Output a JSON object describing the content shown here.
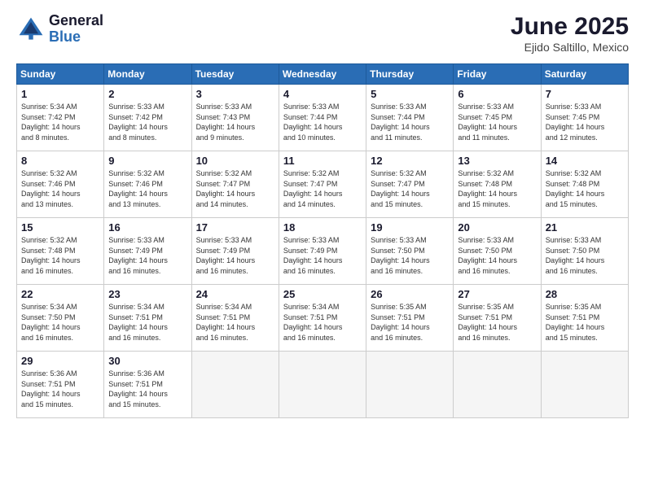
{
  "logo": {
    "general": "General",
    "blue": "Blue"
  },
  "title": "June 2025",
  "subtitle": "Ejido Saltillo, Mexico",
  "days_header": [
    "Sunday",
    "Monday",
    "Tuesday",
    "Wednesday",
    "Thursday",
    "Friday",
    "Saturday"
  ],
  "weeks": [
    [
      {
        "day": "1",
        "info": "Sunrise: 5:34 AM\nSunset: 7:42 PM\nDaylight: 14 hours\nand 8 minutes."
      },
      {
        "day": "2",
        "info": "Sunrise: 5:33 AM\nSunset: 7:42 PM\nDaylight: 14 hours\nand 8 minutes."
      },
      {
        "day": "3",
        "info": "Sunrise: 5:33 AM\nSunset: 7:43 PM\nDaylight: 14 hours\nand 9 minutes."
      },
      {
        "day": "4",
        "info": "Sunrise: 5:33 AM\nSunset: 7:44 PM\nDaylight: 14 hours\nand 10 minutes."
      },
      {
        "day": "5",
        "info": "Sunrise: 5:33 AM\nSunset: 7:44 PM\nDaylight: 14 hours\nand 11 minutes."
      },
      {
        "day": "6",
        "info": "Sunrise: 5:33 AM\nSunset: 7:45 PM\nDaylight: 14 hours\nand 11 minutes."
      },
      {
        "day": "7",
        "info": "Sunrise: 5:33 AM\nSunset: 7:45 PM\nDaylight: 14 hours\nand 12 minutes."
      }
    ],
    [
      {
        "day": "8",
        "info": "Sunrise: 5:32 AM\nSunset: 7:46 PM\nDaylight: 14 hours\nand 13 minutes."
      },
      {
        "day": "9",
        "info": "Sunrise: 5:32 AM\nSunset: 7:46 PM\nDaylight: 14 hours\nand 13 minutes."
      },
      {
        "day": "10",
        "info": "Sunrise: 5:32 AM\nSunset: 7:47 PM\nDaylight: 14 hours\nand 14 minutes."
      },
      {
        "day": "11",
        "info": "Sunrise: 5:32 AM\nSunset: 7:47 PM\nDaylight: 14 hours\nand 14 minutes."
      },
      {
        "day": "12",
        "info": "Sunrise: 5:32 AM\nSunset: 7:47 PM\nDaylight: 14 hours\nand 15 minutes."
      },
      {
        "day": "13",
        "info": "Sunrise: 5:32 AM\nSunset: 7:48 PM\nDaylight: 14 hours\nand 15 minutes."
      },
      {
        "day": "14",
        "info": "Sunrise: 5:32 AM\nSunset: 7:48 PM\nDaylight: 14 hours\nand 15 minutes."
      }
    ],
    [
      {
        "day": "15",
        "info": "Sunrise: 5:32 AM\nSunset: 7:48 PM\nDaylight: 14 hours\nand 16 minutes."
      },
      {
        "day": "16",
        "info": "Sunrise: 5:33 AM\nSunset: 7:49 PM\nDaylight: 14 hours\nand 16 minutes."
      },
      {
        "day": "17",
        "info": "Sunrise: 5:33 AM\nSunset: 7:49 PM\nDaylight: 14 hours\nand 16 minutes."
      },
      {
        "day": "18",
        "info": "Sunrise: 5:33 AM\nSunset: 7:49 PM\nDaylight: 14 hours\nand 16 minutes."
      },
      {
        "day": "19",
        "info": "Sunrise: 5:33 AM\nSunset: 7:50 PM\nDaylight: 14 hours\nand 16 minutes."
      },
      {
        "day": "20",
        "info": "Sunrise: 5:33 AM\nSunset: 7:50 PM\nDaylight: 14 hours\nand 16 minutes."
      },
      {
        "day": "21",
        "info": "Sunrise: 5:33 AM\nSunset: 7:50 PM\nDaylight: 14 hours\nand 16 minutes."
      }
    ],
    [
      {
        "day": "22",
        "info": "Sunrise: 5:34 AM\nSunset: 7:50 PM\nDaylight: 14 hours\nand 16 minutes."
      },
      {
        "day": "23",
        "info": "Sunrise: 5:34 AM\nSunset: 7:51 PM\nDaylight: 14 hours\nand 16 minutes."
      },
      {
        "day": "24",
        "info": "Sunrise: 5:34 AM\nSunset: 7:51 PM\nDaylight: 14 hours\nand 16 minutes."
      },
      {
        "day": "25",
        "info": "Sunrise: 5:34 AM\nSunset: 7:51 PM\nDaylight: 14 hours\nand 16 minutes."
      },
      {
        "day": "26",
        "info": "Sunrise: 5:35 AM\nSunset: 7:51 PM\nDaylight: 14 hours\nand 16 minutes."
      },
      {
        "day": "27",
        "info": "Sunrise: 5:35 AM\nSunset: 7:51 PM\nDaylight: 14 hours\nand 16 minutes."
      },
      {
        "day": "28",
        "info": "Sunrise: 5:35 AM\nSunset: 7:51 PM\nDaylight: 14 hours\nand 15 minutes."
      }
    ],
    [
      {
        "day": "29",
        "info": "Sunrise: 5:36 AM\nSunset: 7:51 PM\nDaylight: 14 hours\nand 15 minutes."
      },
      {
        "day": "30",
        "info": "Sunrise: 5:36 AM\nSunset: 7:51 PM\nDaylight: 14 hours\nand 15 minutes."
      },
      {
        "day": "",
        "info": ""
      },
      {
        "day": "",
        "info": ""
      },
      {
        "day": "",
        "info": ""
      },
      {
        "day": "",
        "info": ""
      },
      {
        "day": "",
        "info": ""
      }
    ]
  ]
}
